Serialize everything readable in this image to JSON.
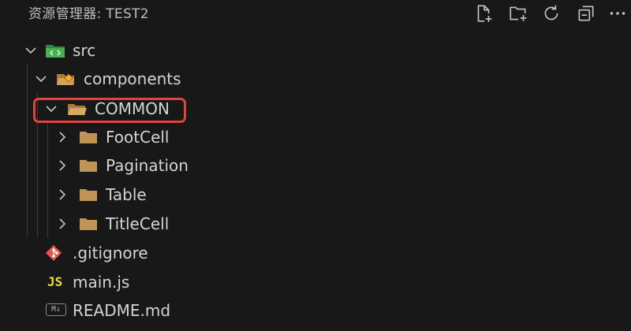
{
  "explorer": {
    "title": "资源管理器: TEST2",
    "actions": [
      {
        "name": "new-file-icon"
      },
      {
        "name": "new-folder-icon"
      },
      {
        "name": "refresh-icon"
      },
      {
        "name": "collapse-all-icon"
      },
      {
        "name": "more-icon"
      }
    ]
  },
  "tree": {
    "src": {
      "label": "src",
      "icon": "folder-src-icon",
      "expanded": true
    },
    "components": {
      "label": "components",
      "icon": "folder-components-icon",
      "expanded": true
    },
    "common": {
      "label": "COMMON",
      "icon": "folder-open-icon",
      "expanded": true,
      "highlighted": true
    },
    "children": [
      {
        "label": "FootCell"
      },
      {
        "label": "Pagination"
      },
      {
        "label": "Table"
      },
      {
        "label": "TitleCell"
      }
    ],
    "files": {
      "gitignore": {
        "label": ".gitignore",
        "icon": "git-icon"
      },
      "main": {
        "label": "main.js",
        "icon_text": "JS"
      },
      "readme": {
        "label": "README.md",
        "icon_text": "M↓"
      }
    }
  },
  "colors": {
    "background": "#181818",
    "highlight": "#e0443a",
    "folder": "#c09553",
    "src_folder": "#4caf50",
    "js": "#f1dd35",
    "git": "#e2574c"
  }
}
